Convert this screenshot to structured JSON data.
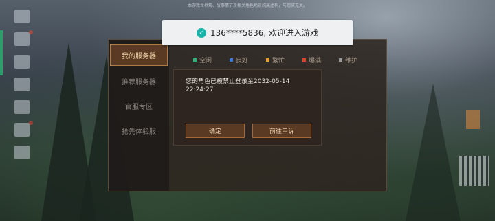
{
  "disclaimer": "本游戏世界观、故事情节及相关角色场景纯属虚构，与现实无关。",
  "toast": {
    "icon": "check-badge-icon",
    "text": "136****5836, 欢迎进入游戏"
  },
  "sidebar": {
    "items": [
      {
        "label": "我的服务器",
        "active": true
      },
      {
        "label": "推荐服务器",
        "active": false
      },
      {
        "label": "官服专区",
        "active": false
      },
      {
        "label": "抢先体验服",
        "active": false
      }
    ]
  },
  "legend": [
    {
      "label": "空闲",
      "color": "#2fb37a"
    },
    {
      "label": "良好",
      "color": "#3b7bd6"
    },
    {
      "label": "繁忙",
      "color": "#e3a13a"
    },
    {
      "label": "爆满",
      "color": "#d8462f"
    },
    {
      "label": "维护",
      "color": "#9a9a9a"
    }
  ],
  "dialog": {
    "message": "您的角色已被禁止登录至2032-05-14 22:24:27",
    "confirm": "确定",
    "appeal": "前往申诉"
  },
  "left_icons": [
    "menu-icon",
    "user-icon",
    "server-list-icon",
    "announcement-icon",
    "image-icon",
    "gift-icon",
    "clipboard-icon"
  ]
}
